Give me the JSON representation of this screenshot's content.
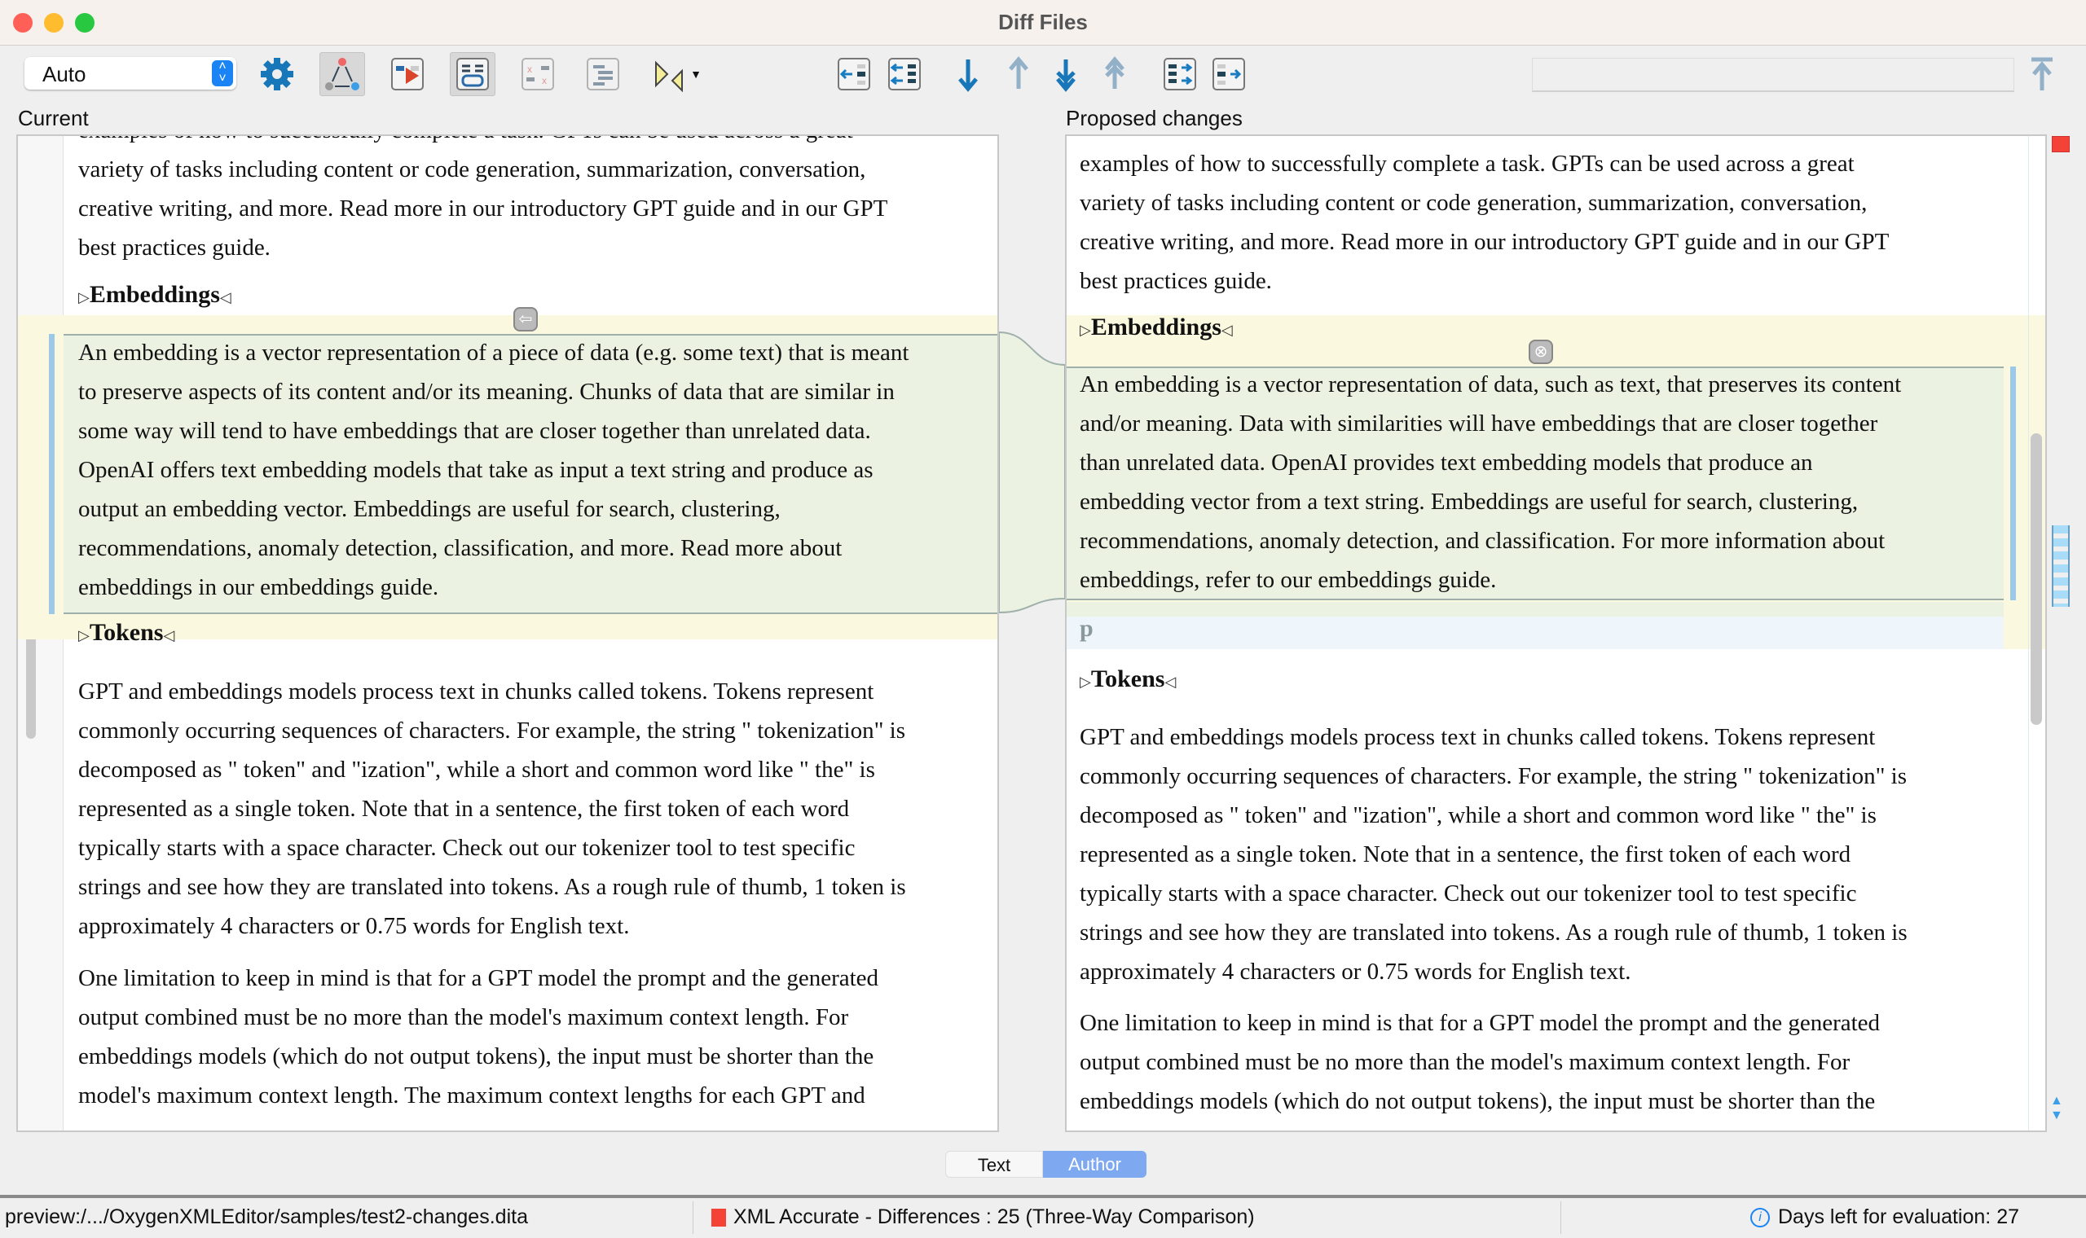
{
  "window": {
    "title": "Diff Files"
  },
  "toolbar": {
    "mode_select": {
      "value": "Auto"
    },
    "icons": [
      "gear-icon",
      "three-way-icon",
      "show-differences-icon",
      "word-diff-icon",
      "ignore-icon",
      "format-icon",
      "merge-markers-icon",
      "copy-change-left-icon",
      "copy-all-left-icon",
      "next-change-icon",
      "previous-change-icon",
      "next-block-icon",
      "previous-block-icon",
      "copy-change-right-icon",
      "copy-all-right-icon",
      "first-change-icon"
    ],
    "search": {
      "value": ""
    }
  },
  "left": {
    "label": "Current",
    "intro": [
      "examples of how to successfully complete a task. GPTs can be used across a great",
      "variety of tasks including content or code generation, summarization, conversation,",
      "creative writing, and more. Read more in our introductory GPT guide and in our GPT",
      "best practices guide."
    ],
    "heading1": "Embeddings",
    "para1": [
      "An embedding is a vector representation of a piece of data (e.g. some text) that is meant",
      "to preserve aspects of its content and/or its meaning. Chunks of data that are similar in",
      "some way will tend to have embeddings that are closer together than unrelated data.",
      "OpenAI offers text embedding models that take as input a text string and produce as",
      "output an embedding vector. Embeddings are useful for search, clustering,",
      "recommendations, anomaly detection, classification, and more. Read more about",
      "embeddings in our embeddings guide."
    ],
    "heading2": "Tokens",
    "para2": [
      "GPT and embeddings models process text in chunks called tokens. Tokens represent",
      "commonly occurring sequences of characters. For example, the string \" tokenization\" is",
      "decomposed as \" token\" and \"ization\", while a short and common word like \" the\" is",
      "represented as a single token. Note that in a sentence, the first token of each word",
      "typically starts with a space character. Check out our tokenizer tool to test specific",
      "strings and see how they are translated into tokens. As a rough rule of thumb, 1 token is",
      "approximately 4 characters or 0.75 words for English text."
    ],
    "para3": [
      "One limitation to keep in mind is that for a GPT model the prompt and the generated",
      "output combined must be no more than the model's maximum context length. For",
      "embeddings models (which do not output tokens), the input must be shorter than the",
      "model's maximum context length. The maximum context lengths for each GPT and"
    ]
  },
  "right": {
    "label": "Proposed changes",
    "intro": [
      "examples of how to successfully complete a task. GPTs can be used across a great",
      "variety of tasks including content or code generation, summarization, conversation,",
      "creative writing, and more. Read more in our introductory GPT guide and in our GPT",
      "best practices guide."
    ],
    "heading1": "Embeddings",
    "para1": [
      "An embedding is a vector representation of data, such as text, that preserves its content",
      "and/or meaning. Data with similarities will have embeddings that are closer together",
      "than unrelated data. OpenAI provides text embedding models that produce an",
      "embedding vector from a text string. Embeddings are useful for search, clustering,",
      "recommendations, anomaly detection, and classification. For more information about",
      "embeddings, refer to our embeddings guide."
    ],
    "empty_element": "p",
    "heading2": "Tokens",
    "para2": [
      "GPT and embeddings models process text in chunks called tokens. Tokens represent",
      "commonly occurring sequences of characters. For example, the string \" tokenization\" is",
      "decomposed as \" token\" and \"ization\", while a short and common word like \" the\" is",
      "represented as a single token. Note that in a sentence, the first token of each word",
      "typically starts with a space character. Check out our tokenizer tool to test specific",
      "strings and see how they are translated into tokens. As a rough rule of thumb, 1 token is",
      "approximately 4 characters or 0.75 words for English text."
    ],
    "para3": [
      "One limitation to keep in mind is that for a GPT model the prompt and the generated",
      "output combined must be no more than the model's maximum context length. For",
      "embeddings models (which do not output tokens), the input must be shorter than the"
    ]
  },
  "tag_open": "▷",
  "tag_close": "◁",
  "view_toggle": {
    "options": [
      "Text",
      "Author"
    ],
    "selected": "Author"
  },
  "status": {
    "path": "preview:/.../OxygenXMLEditor/samples/test2-changes.dita",
    "comparison": "XML Accurate - Differences : 25 (Three-Way Comparison)",
    "evaluation": "Days left for evaluation: 27"
  },
  "colors": {
    "change_band": "#fbf8e0",
    "change_text": "#ecf2e2",
    "word_highlight": "#d8ebe4",
    "accent": "#1a84f5",
    "marker": "#f44336"
  }
}
